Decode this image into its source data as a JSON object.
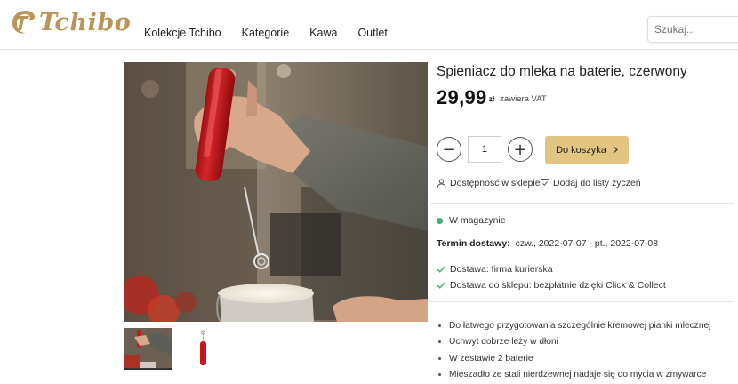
{
  "header": {
    "logo_text": "Tchibo",
    "nav": [
      "Kolekcje Tchibo",
      "Kategorie",
      "Kawa",
      "Outlet"
    ],
    "search_placeholder": "Szukaj..."
  },
  "product": {
    "title": "Spieniacz do mleka na baterie, czerwony",
    "price": "29,99",
    "currency": "zł",
    "vat_note": "zawiera VAT",
    "quantity": "1",
    "add_to_cart": "Do koszyka",
    "store_availability": "Dostępność w sklepie",
    "wishlist": "Dodaj do listy życzeń",
    "stock_status": "W magazynie",
    "delivery_label": "Termin dostawy:",
    "delivery_value": "czw., 2022-07-07 - pt., 2022-07-08",
    "shipping_options": [
      "Dostawa: firma kurierska",
      "Dostawa do sklepu: bezpłatnie dzięki Click & Collect"
    ],
    "features": [
      "Do łatwego przygotowania szczególnie kremowej pianki mlecznej",
      "Uchwyt dobrze leży w dłoni",
      "W zestawie 2 baterie",
      "Mieszadło ze stali nierdzewnej nadaje się do mycia w zmywarce"
    ]
  },
  "colors": {
    "brand_gold": "#b9955a",
    "cart_button": "#e3c582",
    "stock_dot": "#3cb371",
    "check": "#3cb371",
    "product_red": "#c8181c"
  }
}
